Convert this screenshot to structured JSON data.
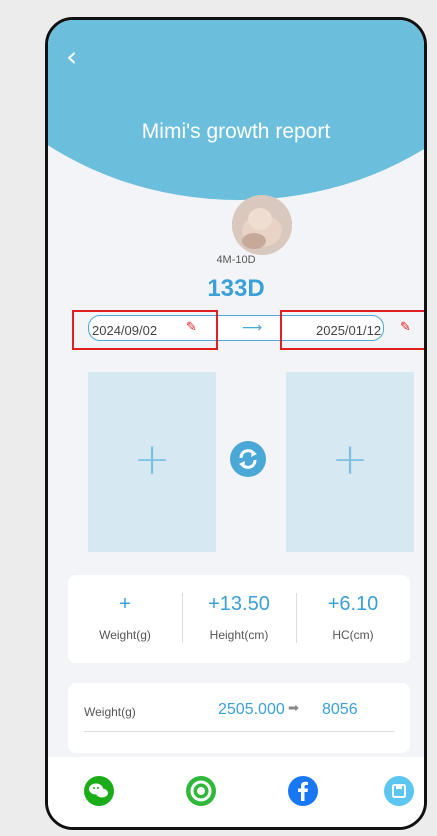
{
  "header": {
    "title": "Mimi's growth report",
    "back_icon": "chevron-left-icon"
  },
  "baby": {
    "age": "4M-10D",
    "days": "133D"
  },
  "dates": {
    "start": "2024/09/02",
    "end": "2025/01/12"
  },
  "stats": [
    {
      "value": "+",
      "label": "Weight(g)"
    },
    {
      "value": "+13.50",
      "label": "Height(cm)"
    },
    {
      "value": "+6.10",
      "label": "HC(cm)"
    }
  ],
  "detail": {
    "label": "Weight(g)",
    "from": "2505.000",
    "to": "8056"
  },
  "share": [
    "wechat-icon",
    "camera-icon",
    "facebook-icon",
    "save-icon"
  ],
  "colors": {
    "accent": "#3aa0d8",
    "header": "#6bbfdd",
    "highlight": "#e02020"
  }
}
